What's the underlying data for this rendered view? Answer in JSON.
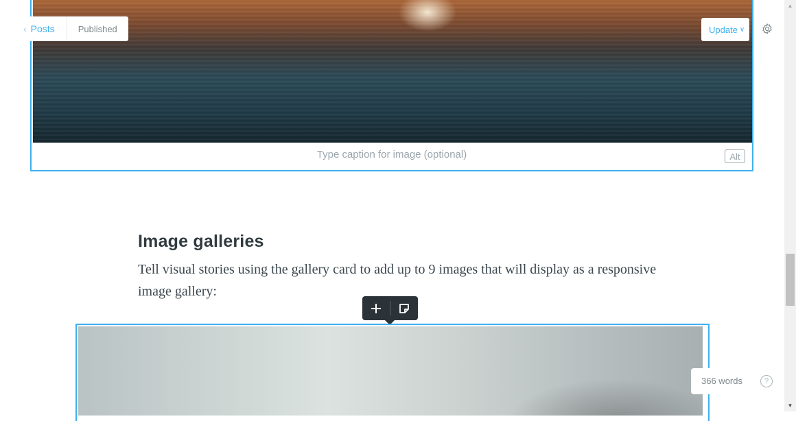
{
  "header": {
    "back_label": "Posts",
    "status": "Published",
    "update_label": "Update",
    "settings_icon": "gear-icon"
  },
  "image_card": {
    "caption_placeholder": "Type caption for image (optional)",
    "alt_label": "Alt"
  },
  "content": {
    "heading": "Image galleries",
    "paragraph": "Tell visual stories using the gallery card to add up to 9 images that will display as a responsive image gallery:"
  },
  "card_toolbar": {
    "add_icon": "plus-icon",
    "snippet_icon": "snippet-icon"
  },
  "footer": {
    "word_count": "366 words",
    "help_label": "?"
  },
  "scrollbar": {
    "position": 0.62
  },
  "colors": {
    "accent": "#3eb0ef",
    "toolbar_bg": "#2b3338",
    "text": "#313b3f"
  }
}
